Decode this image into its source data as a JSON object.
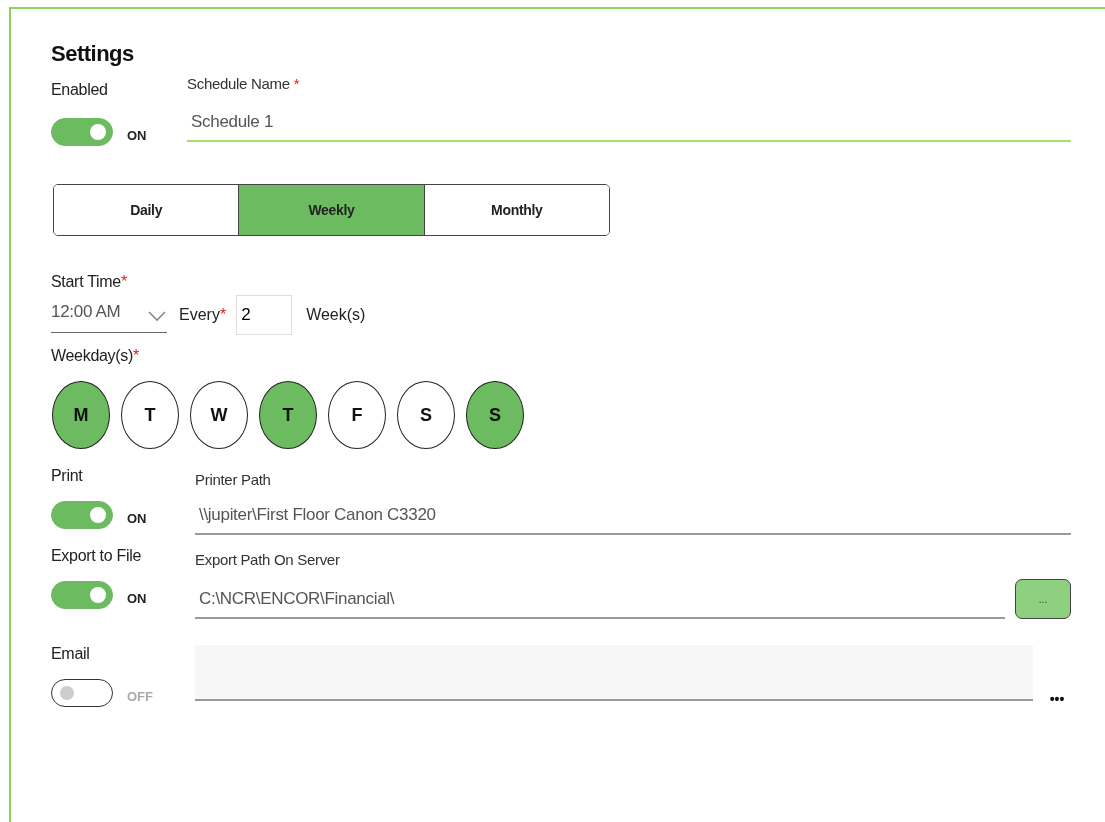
{
  "title": "Settings",
  "enabled": {
    "label": "Enabled",
    "on": true,
    "state_text": "ON"
  },
  "schedule_name": {
    "label": "Schedule Name",
    "required_mark": "*",
    "value": "Schedule 1"
  },
  "frequency_tabs": [
    {
      "label": "Daily",
      "selected": false
    },
    {
      "label": "Weekly",
      "selected": true
    },
    {
      "label": "Monthly",
      "selected": false
    }
  ],
  "start_time": {
    "label": "Start Time",
    "required_mark": "*",
    "value": "12:00 AM"
  },
  "every": {
    "label": "Every",
    "required_mark": "*",
    "value": "2",
    "unit": "Week(s)"
  },
  "weekdays": {
    "label": "Weekday(s)",
    "required_mark": "*",
    "days": [
      {
        "label": "M",
        "selected": true
      },
      {
        "label": "T",
        "selected": false
      },
      {
        "label": "W",
        "selected": false
      },
      {
        "label": "T",
        "selected": true
      },
      {
        "label": "F",
        "selected": false
      },
      {
        "label": "S",
        "selected": false
      },
      {
        "label": "S",
        "selected": true
      }
    ]
  },
  "outputs": [
    {
      "kind": "path",
      "label": "Print",
      "on": true,
      "state_text": "ON",
      "field_label": "Printer Path",
      "value": "\\\\jupiter\\First Floor Canon C3320"
    },
    {
      "kind": "browse",
      "label": "Export to File",
      "on": true,
      "state_text": "ON",
      "field_label": "Export Path On Server",
      "value": "C:\\NCR\\ENCOR\\Financial\\",
      "button": "..."
    },
    {
      "kind": "more",
      "label": "Email",
      "on": false,
      "state_text": "OFF",
      "more": "•••"
    }
  ]
}
